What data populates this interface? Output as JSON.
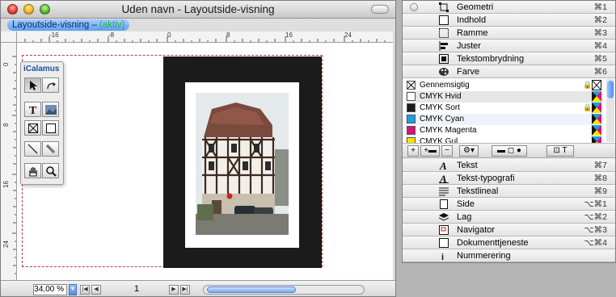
{
  "document": {
    "title": "Uden navn - Layoutside-visning",
    "layer_label": "Layoutside-visning –",
    "layer_state": "(aktiv)",
    "ruler_h": [
      "-16",
      "-8",
      "0",
      "8",
      "16",
      "24"
    ],
    "ruler_v": [
      "0",
      "8",
      "16",
      "24"
    ],
    "zoom": "34,00 %",
    "page_number": "1"
  },
  "toolbox": {
    "title": "iCalamus"
  },
  "palettes": {
    "top_items": [
      {
        "label": "Geometri",
        "shortcut": "⌘1",
        "icon": "geometry-icon"
      },
      {
        "label": "Indhold",
        "shortcut": "⌘2",
        "icon": "content-icon"
      },
      {
        "label": "Ramme",
        "shortcut": "⌘3",
        "icon": "frame-icon"
      },
      {
        "label": "Juster",
        "shortcut": "⌘4",
        "icon": "align-icon"
      },
      {
        "label": "Tekstombrydning",
        "shortcut": "⌘5",
        "icon": "text-wrap-icon"
      },
      {
        "label": "Farve",
        "shortcut": "⌘6",
        "icon": "palette-icon"
      }
    ],
    "colors": [
      {
        "name": "Gennemsigtig",
        "swatch": "#ffffff",
        "locked": true
      },
      {
        "name": "CMYK Hvid",
        "swatch": "#ffffff",
        "locked": false
      },
      {
        "name": "CMYK Sort",
        "swatch": "#1a1a1a",
        "locked": true
      },
      {
        "name": "CMYK Cyan",
        "swatch": "#1a9fe0",
        "locked": false
      },
      {
        "name": "CMYK Magenta",
        "swatch": "#d4147a",
        "locked": false
      },
      {
        "name": "CMYK Gul",
        "swatch": "#f5e600",
        "locked": false
      }
    ],
    "bottom_items": [
      {
        "label": "Tekst",
        "shortcut": "⌘7",
        "icon": "text-icon"
      },
      {
        "label": "Tekst-typografi",
        "shortcut": "⌘8",
        "icon": "typography-icon"
      },
      {
        "label": "Tekstlineal",
        "shortcut": "⌘9",
        "icon": "text-ruler-icon"
      },
      {
        "label": "Side",
        "shortcut": "⌥⌘1",
        "icon": "page-icon"
      },
      {
        "label": "Lag",
        "shortcut": "⌥⌘2",
        "icon": "layers-icon"
      },
      {
        "label": "Navigator",
        "shortcut": "⌥⌘3",
        "icon": "navigator-icon"
      },
      {
        "label": "Dokumenttjeneste",
        "shortcut": "⌥⌘4",
        "icon": "document-service-icon"
      },
      {
        "label": "Nummerering",
        "shortcut": "",
        "icon": "numbering-icon"
      }
    ]
  }
}
